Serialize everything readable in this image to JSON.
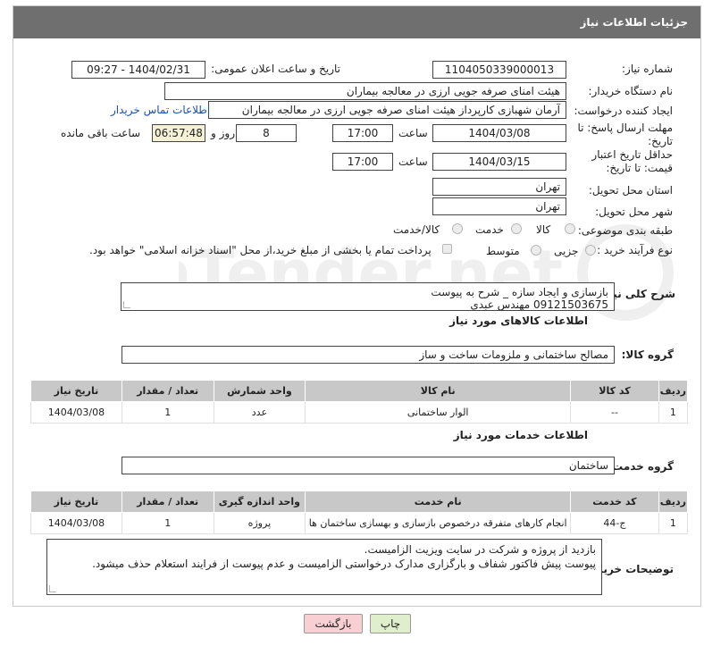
{
  "header": {
    "title": "جزئیات اطلاعات نیاز"
  },
  "fields": {
    "need_number_label": "شماره نیاز:",
    "need_number": "1104050339000013",
    "announce_label": "تاریخ و ساعت اعلان عمومی:",
    "announce_value": "1404/02/31 - 09:27",
    "buyer_org_label": "نام دستگاه خریدار:",
    "buyer_org": "هیئت امنای صرفه جویی ارزی در معالجه بیماران",
    "creator_label": "ایجاد کننده درخواست:",
    "creator": "آرمان شهبازی کارپرداز هیئت امنای صرفه جویی ارزی در معالجه بیماران",
    "contact_link": "اطلاعات تماس خریدار",
    "reply_deadline_label": "مهلت ارسال پاسخ: تا تاریخ:",
    "reply_date": "1404/03/08",
    "time_label": "ساعت",
    "reply_time": "17:00",
    "days": "8",
    "days_label": "روز و",
    "remaining_time": "06:57:48",
    "remaining_label": "ساعت باقی مانده",
    "price_validity_label": "حداقل تاریخ اعتبار قیمت: تا تاریخ:",
    "price_date": "1404/03/15",
    "price_time": "17:00",
    "province_label": "استان محل تحویل:",
    "province": "تهران",
    "city_label": "شهر محل تحویل:",
    "city": "تهران",
    "category_label": "طبقه بندی موضوعی:",
    "category_options": [
      "کالا",
      "خدمت",
      "کالا/خدمت"
    ],
    "process_label": "نوع فرآیند خرید :",
    "process_options": [
      "جزیی",
      "متوسط"
    ],
    "payment_note": "پرداخت تمام یا بخشی از مبلغ خرید،از محل \"اسناد خزانه اسلامی\" خواهد بود."
  },
  "description": {
    "label": "شرح کلی نیاز:",
    "lines": [
      "بازسازی و ایجاد سازه _ شرح به پیوست",
      "09121503675 مهندس عبدی"
    ]
  },
  "goods": {
    "section_title": "اطلاعات کالاهای مورد نیاز",
    "group_label": "گروه کالا:",
    "group_value": "مصالح ساختمانی و ملزومات ساخت و ساز",
    "columns": [
      "ردیف",
      "کد کالا",
      "نام کالا",
      "واحد شمارش",
      "تعداد / مقدار",
      "تاریخ نیاز"
    ],
    "rows": [
      [
        "1",
        "--",
        "الوار ساختمانی",
        "عدد",
        "1",
        "1404/03/08"
      ]
    ]
  },
  "services": {
    "section_title": "اطلاعات خدمات مورد نیاز",
    "group_label": "گروه خدمت:",
    "group_value": "ساختمان",
    "columns": [
      "ردیف",
      "کد خدمت",
      "نام خدمت",
      "واحد اندازه گیری",
      "تعداد / مقدار",
      "تاریخ نیاز"
    ],
    "rows": [
      [
        "1",
        "ج-44",
        "انجام کارهای متفرقه درخصوص بازسازی و بهسازی ساختمان ها",
        "پروژه",
        "1",
        "1404/03/08"
      ]
    ]
  },
  "buyer_notes": {
    "label": "توضیحات خریدار:",
    "lines": [
      "بازدید از پروژه و شرکت در سایت ویزیت الزامیست.",
      "پیوست پیش فاکتور شفاف و بارگزاری مدارک درخواستی الزامیست و عدم پیوست از فرایند استعلام حذف میشود."
    ]
  },
  "buttons": {
    "print": "چاپ",
    "back": "بازگشت"
  },
  "colors": {
    "header_bg": "#6f6f6f",
    "table_header_bg": "#c8c8c8",
    "link": "#1a4fa8",
    "back_btn_bg": "#f8d0d4",
    "print_btn_bg": "#dfeecb"
  }
}
